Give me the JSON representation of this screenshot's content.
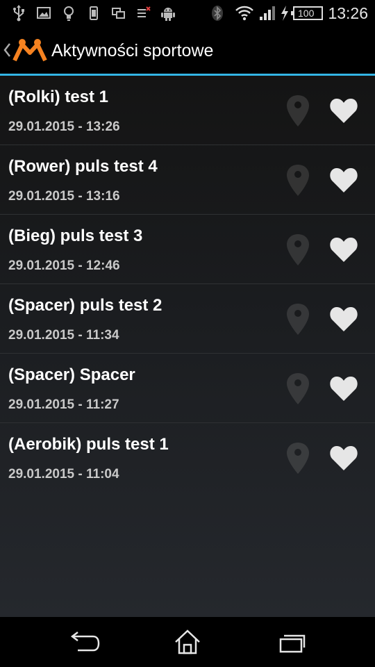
{
  "status_bar": {
    "time": "13:26",
    "battery": "100",
    "icons": [
      "usb-icon",
      "image-icon",
      "lightbulb-icon",
      "phone-icon",
      "screens-icon",
      "signal-off-icon",
      "android-icon",
      "bluetooth-icon",
      "wifi-icon",
      "cell-signal-icon",
      "charging-icon",
      "battery-icon"
    ]
  },
  "action_bar": {
    "title": "Aktywności sportowe",
    "logo_color": "#f58220",
    "accent_color": "#33b5e5"
  },
  "activities": [
    {
      "title": "(Rolki) test 1",
      "date": "29.01.2015 - 13:26"
    },
    {
      "title": "(Rower) puls test 4",
      "date": "29.01.2015 - 13:16"
    },
    {
      "title": "(Bieg) puls test 3",
      "date": "29.01.2015 - 12:46"
    },
    {
      "title": "(Spacer) puls test 2",
      "date": "29.01.2015 - 11:34"
    },
    {
      "title": "(Spacer) Spacer",
      "date": "29.01.2015 - 11:27"
    },
    {
      "title": "(Aerobik) puls test 1",
      "date": "29.01.2015 - 11:04"
    }
  ],
  "nav_bar": {
    "icons": [
      "back-icon",
      "home-icon",
      "recent-apps-icon"
    ]
  }
}
